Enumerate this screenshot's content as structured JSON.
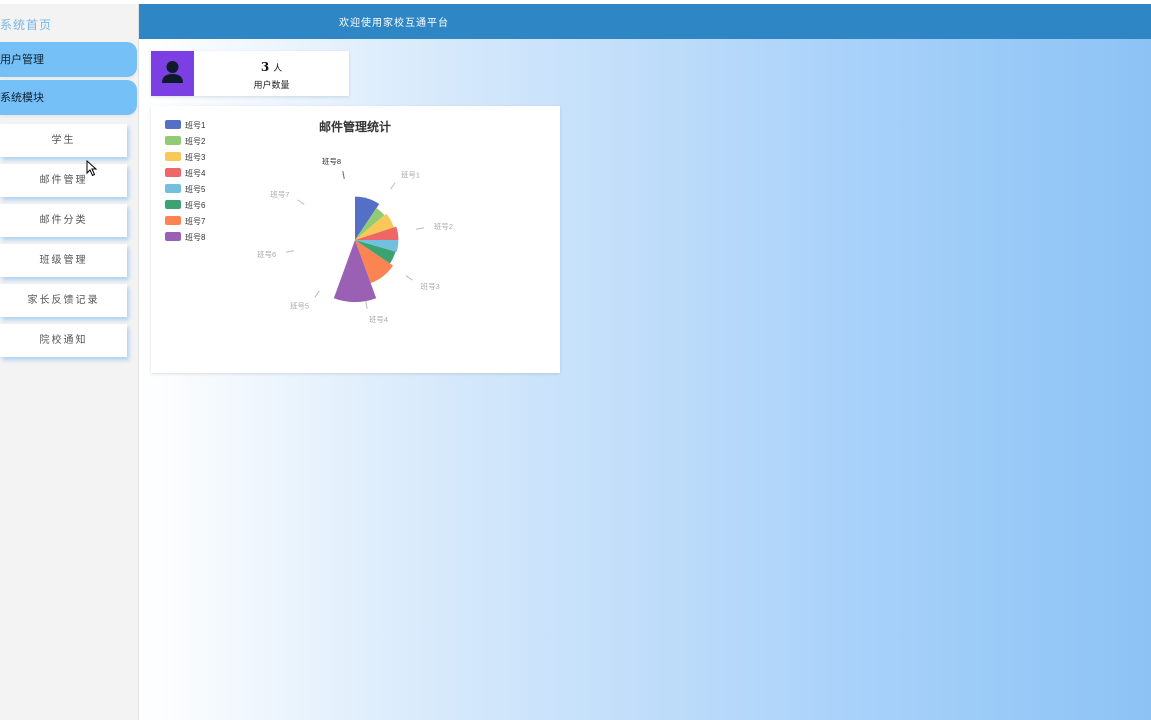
{
  "sidebar": {
    "home_label": "系统首页",
    "menus": [
      {
        "label": "用户管理"
      },
      {
        "label": "系统模块"
      }
    ],
    "items": [
      {
        "label": "学生"
      },
      {
        "label": "邮件管理"
      },
      {
        "label": "邮件分类"
      },
      {
        "label": "班级管理"
      },
      {
        "label": "家长反馈记录"
      },
      {
        "label": "院校通知"
      }
    ]
  },
  "header": {
    "title": "欢迎使用家校互通平台"
  },
  "stats": {
    "count": "3",
    "unit": "人",
    "label": "用户数量"
  },
  "colors": {
    "header_bg": "#2e86c4",
    "menu_bg": "#74c0f7",
    "user_icon_bg": "#7b3fe4"
  },
  "chart_data": {
    "type": "pie",
    "variant": "rose",
    "title": "邮件管理统计",
    "legend_position": "top-left",
    "categories": [
      "班号1",
      "班号2",
      "班号3",
      "班号4",
      "班号5",
      "班号6",
      "班号7",
      "班号8"
    ],
    "colors": [
      "#5470c6",
      "#91cc75",
      "#fac858",
      "#ee6666",
      "#73c0de",
      "#3ba272",
      "#fc8452",
      "#9a60b4"
    ],
    "values": [
      1,
      1,
      1,
      1,
      1,
      1,
      1,
      1
    ],
    "radii": [
      0.7,
      0.62,
      0.66,
      0.7,
      0.7,
      0.68,
      0.74,
      1.0
    ],
    "angles_deg": [
      34,
      16,
      22,
      18,
      16,
      18,
      36,
      40
    ]
  }
}
